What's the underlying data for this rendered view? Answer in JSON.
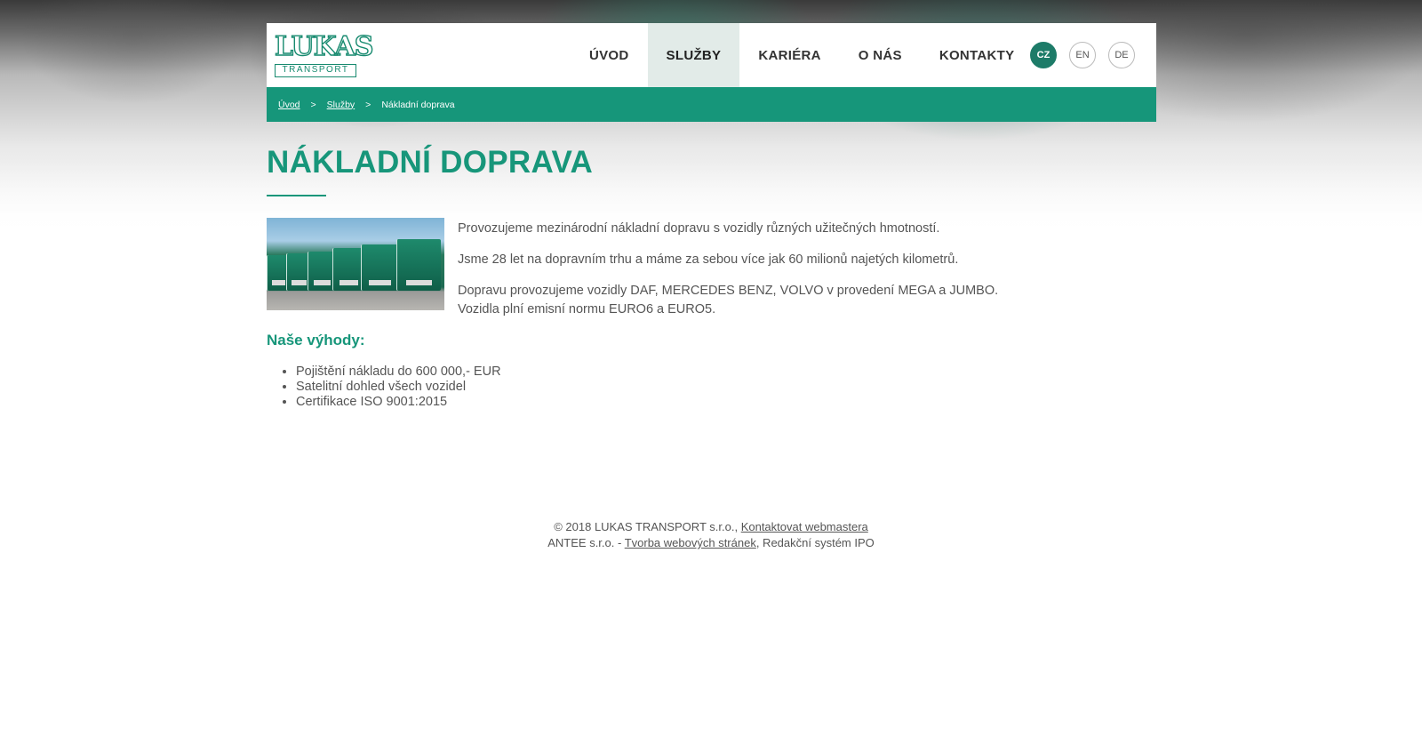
{
  "brand": {
    "logo_word": "LUKAS",
    "logo_sub": "TRANSPORT"
  },
  "nav": {
    "items": [
      {
        "label": "ÚVOD"
      },
      {
        "label": "SLUŽBY"
      },
      {
        "label": "KARIÉRA"
      },
      {
        "label": "O NÁS"
      },
      {
        "label": "KONTAKTY"
      }
    ],
    "active": "SLUŽBY"
  },
  "languages": {
    "items": [
      "CZ",
      "EN",
      "DE"
    ],
    "active": "CZ"
  },
  "breadcrumb": {
    "items": [
      {
        "label": "Úvod"
      },
      {
        "label": "Služby"
      },
      {
        "label": "Nákladní doprava"
      }
    ],
    "separator": ">"
  },
  "page": {
    "title": "NÁKLADNÍ DOPRAVA",
    "paragraphs": [
      "Provozujeme mezinárodní nákladní dopravu s vozidly různých užitečných hmotností.",
      "Jsme 28 let na dopravním trhu a máme za sebou více jak 60 milionů najetých kilometrů.",
      "Dopravu provozujeme vozidly DAF, MERCEDES BENZ, VOLVO v provedení MEGA a JUMBO. Vozidla plní emisní normu EURO6 a EURO5."
    ],
    "benefits_title": "Naše výhody:",
    "benefits": [
      "Pojištění nákladu do 600 000,- EUR",
      "Satelitní dohled všech vozidel",
      "Certifikace ISO 9001:2015"
    ]
  },
  "footer": {
    "line1_prefix": "© 2018 LUKAS TRANSPORT s.r.o.,",
    "line1_link": "Kontaktovat webmastera",
    "line2_prefix": "ANTEE s.r.o. -",
    "line2_link": "Tvorba webových stránek",
    "line2_suffix": ", Redakční systém IPO"
  },
  "colors": {
    "accent": "#17967a",
    "lang_active": "#1d7b68",
    "nav_active_bg": "#e2ebe8"
  }
}
